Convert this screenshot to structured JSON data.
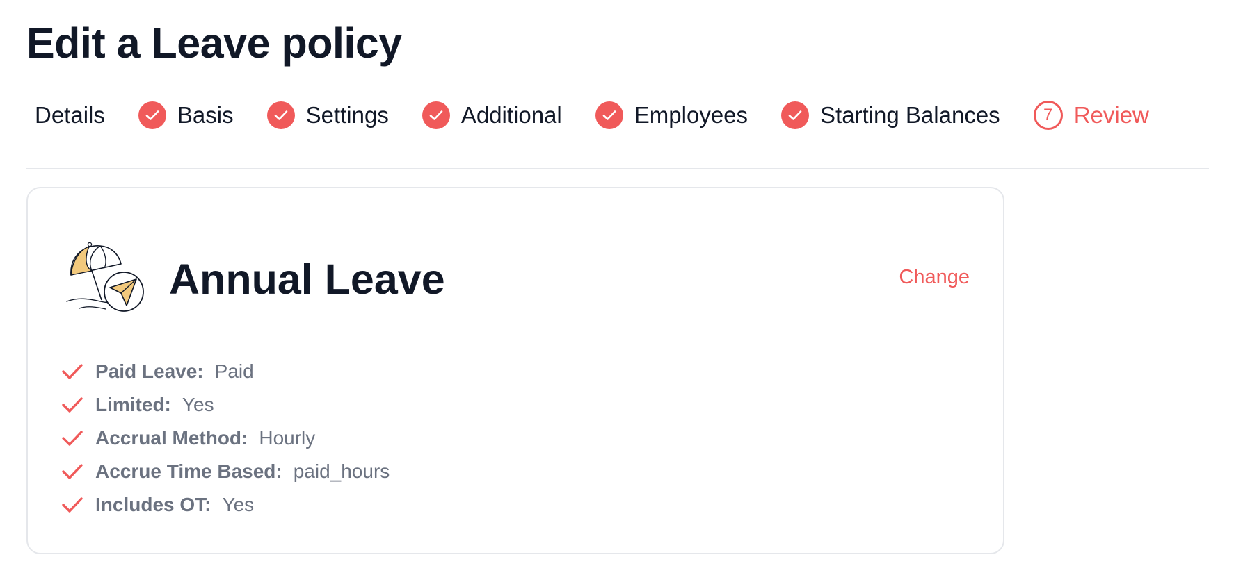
{
  "page": {
    "title": "Edit a Leave policy"
  },
  "stepper": {
    "steps": [
      {
        "label": "Details",
        "state": "plain"
      },
      {
        "label": "Basis",
        "state": "completed"
      },
      {
        "label": "Settings",
        "state": "completed"
      },
      {
        "label": "Additional",
        "state": "completed"
      },
      {
        "label": "Employees",
        "state": "completed"
      },
      {
        "label": "Starting Balances",
        "state": "completed"
      },
      {
        "label": "Review",
        "state": "current",
        "number": "7"
      }
    ]
  },
  "policy": {
    "name": "Annual Leave",
    "illustration_icon": "beach-umbrella-paper-plane-icon",
    "change_label": "Change",
    "summary": [
      {
        "label": "Paid Leave:",
        "value": "Paid"
      },
      {
        "label": "Limited:",
        "value": "Yes"
      },
      {
        "label": "Accrual Method:",
        "value": "Hourly"
      },
      {
        "label": "Accrue Time Based:",
        "value": "paid_hours"
      },
      {
        "label": "Includes OT:",
        "value": "Yes"
      }
    ]
  },
  "colors": {
    "accent": "#f05a5a",
    "text_primary": "#111827",
    "text_secondary": "#6b7280",
    "border": "#e5e7eb",
    "illustration_fill": "#f2c97d"
  }
}
